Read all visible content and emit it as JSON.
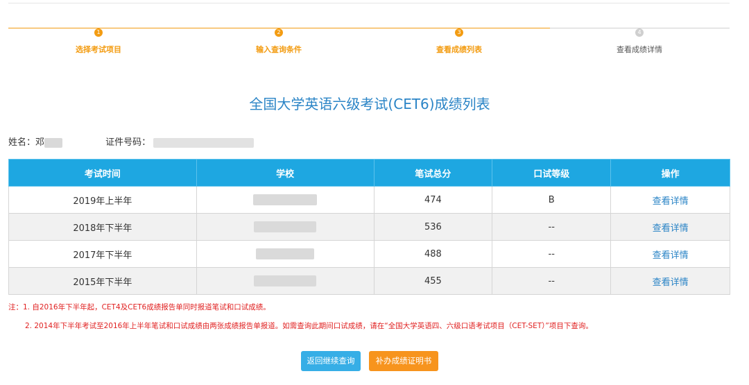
{
  "steps": [
    {
      "num": "1",
      "label": "选择考试项目"
    },
    {
      "num": "2",
      "label": "输入查询条件"
    },
    {
      "num": "3",
      "label": "查看成绩列表"
    },
    {
      "num": "4",
      "label": "查看成绩详情"
    }
  ],
  "title": "全国大学英语六级考试(CET6)成绩列表",
  "info": {
    "name_label": "姓名：",
    "name_value": "邓",
    "id_label": "证件号码："
  },
  "table": {
    "headers": [
      "考试时间",
      "学校",
      "笔试总分",
      "口试等级",
      "操作"
    ],
    "rows": [
      {
        "time": "2019年上半年",
        "score": "474",
        "oral": "B",
        "action": "查看详情"
      },
      {
        "time": "2018年下半年",
        "score": "536",
        "oral": "--",
        "action": "查看详情"
      },
      {
        "time": "2017年下半年",
        "score": "488",
        "oral": "--",
        "action": "查看详情"
      },
      {
        "time": "2015年下半年",
        "score": "455",
        "oral": "--",
        "action": "查看详情"
      }
    ]
  },
  "notes": {
    "n1": "注：1. 自2016年下半年起，CET4及CET6成绩报告单同时报道笔试和口试成绩。",
    "n2": "2. 2014年下半年考试至2016年上半年笔试和口试成绩由两张成绩报告单报道。如需查询此期间口试成绩，请在“全国大学英语四、六级口语考试项目（CET-SET）”项目下查询。"
  },
  "buttons": {
    "back": "返回继续查询",
    "certificate": "补办成绩证明书"
  },
  "colors": {
    "accent": "#f39c12",
    "header": "#1ea7e1",
    "link": "#2a84c6",
    "note": "#e02020"
  }
}
